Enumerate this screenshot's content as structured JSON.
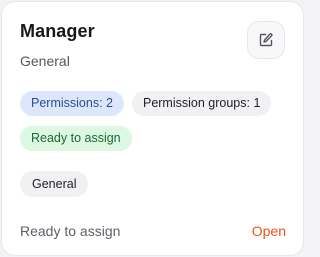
{
  "card": {
    "title": "Manager",
    "subtitle": "General",
    "edit_icon": "pencil-square-icon",
    "badges": {
      "permissions": "Permissions: 2",
      "permission_groups": "Permission groups: 1",
      "status": "Ready to assign"
    },
    "tag": "General",
    "footer": {
      "status": "Ready to assign",
      "open_label": "Open"
    }
  },
  "colors": {
    "accent": "#e8541b",
    "blue_badge_bg": "#dde7fb",
    "green_badge_bg": "#dcf7e2"
  }
}
